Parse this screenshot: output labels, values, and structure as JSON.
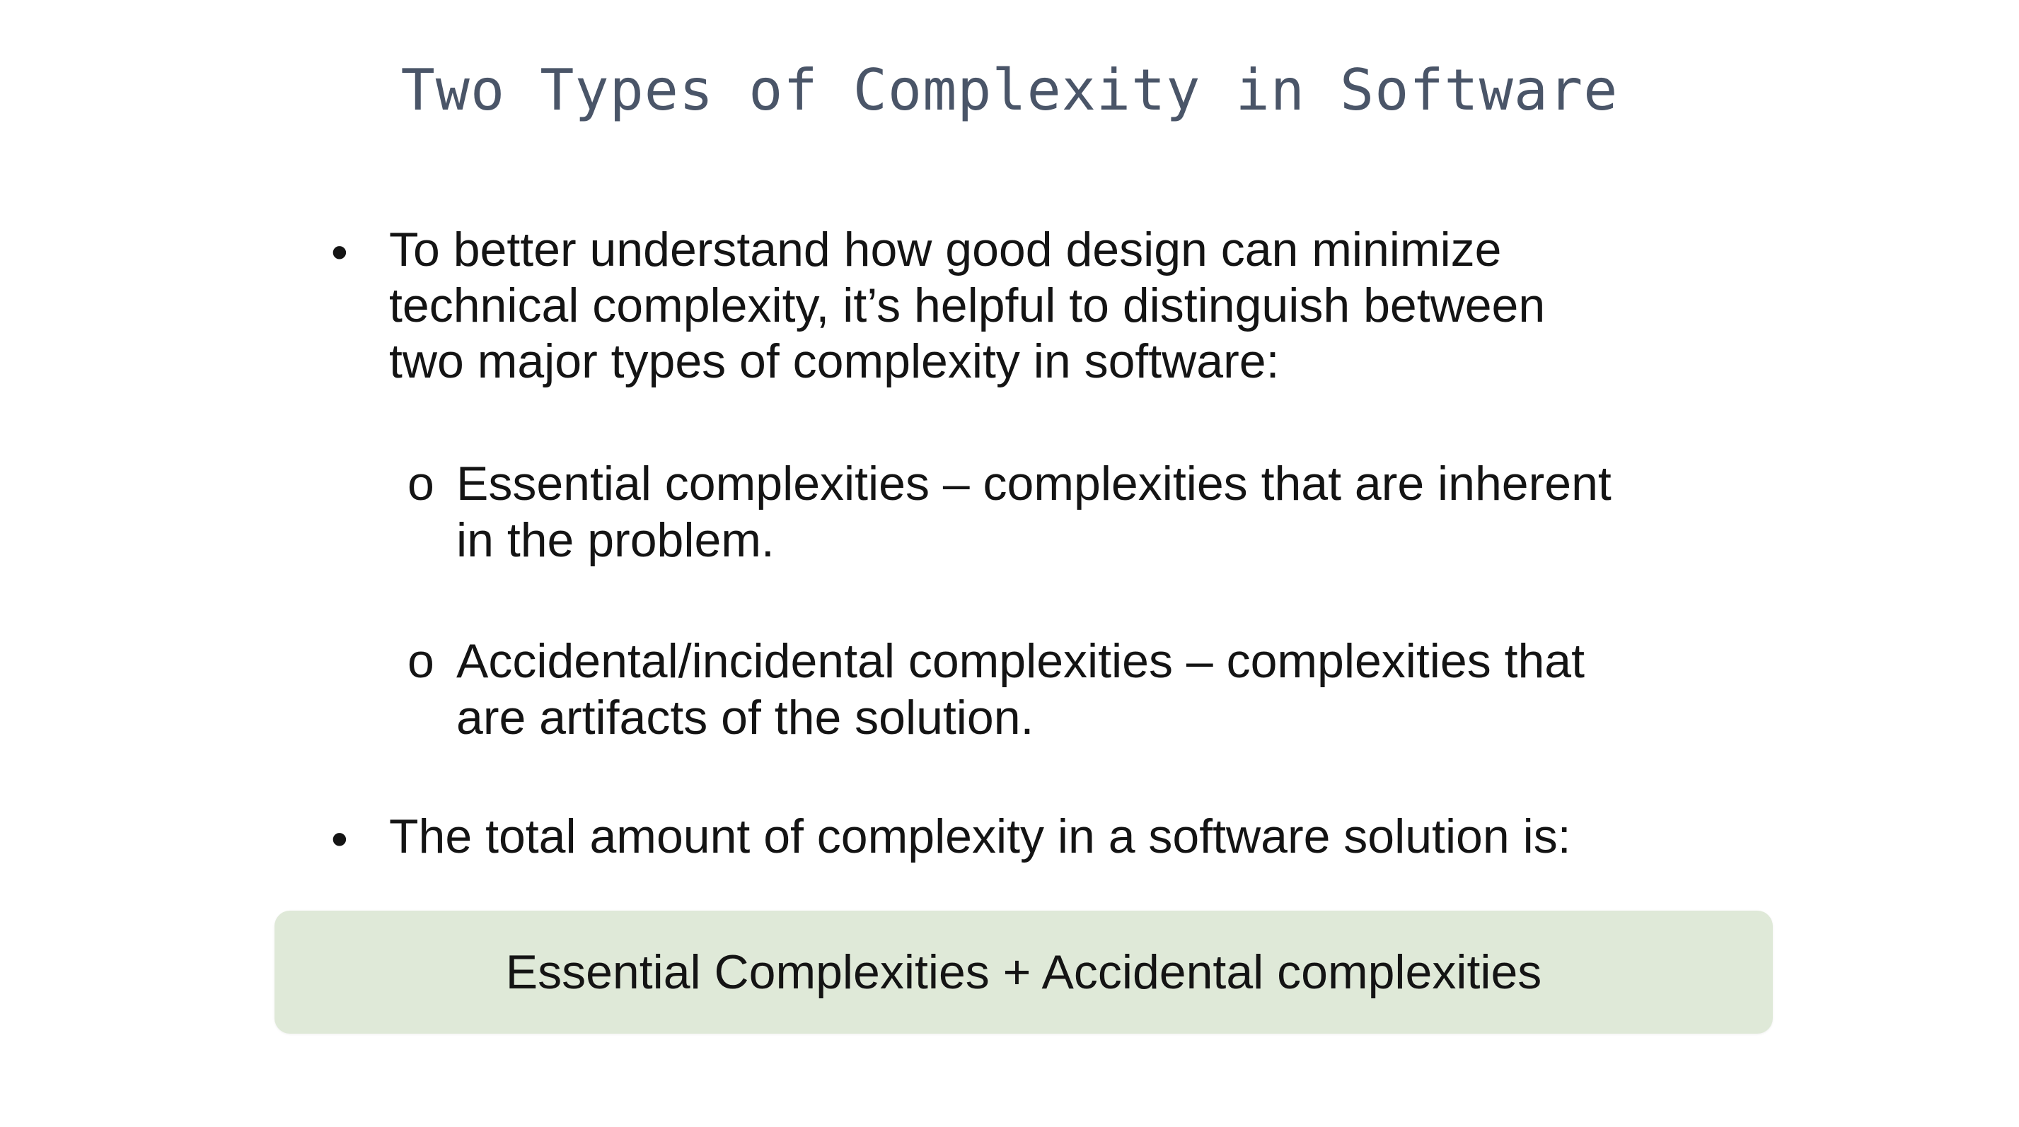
{
  "slide": {
    "title": "Two Types of Complexity in Software",
    "bullets": [
      {
        "marker": "•",
        "lines": [
          "To better understand how good design can minimize",
          "technical complexity, it’s helpful to distinguish between",
          "two major types of complexity in software:"
        ]
      },
      {
        "marker": "•",
        "lines": [
          "The total amount of complexity in a software solution is:"
        ]
      }
    ],
    "sub_bullets": [
      {
        "marker": "o",
        "lines": [
          "Essential complexities – complexities that are inherent",
          "in the problem."
        ]
      },
      {
        "marker": "o",
        "lines": [
          "Accidental/incidental complexities – complexities that",
          "are artifacts of the solution."
        ]
      }
    ],
    "formula": "Essential Complexities + Accidental complexities",
    "colors": {
      "title": "#4a5568",
      "body_text": "#141414",
      "formula_box": "#dfe9d8",
      "background": "#ffffff"
    }
  }
}
